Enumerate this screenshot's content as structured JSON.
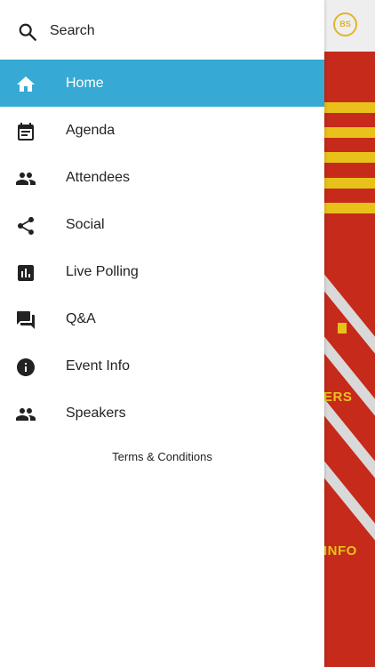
{
  "search": {
    "label": "Search",
    "icon": "search-icon"
  },
  "nav": {
    "active_color": "#36aad4",
    "items": [
      {
        "label": "Home",
        "icon": "home-icon",
        "active": true
      },
      {
        "label": "Agenda",
        "icon": "calendar-icon",
        "active": false
      },
      {
        "label": "Attendees",
        "icon": "people-icon",
        "active": false
      },
      {
        "label": "Social",
        "icon": "share-icon",
        "active": false
      },
      {
        "label": "Live Polling",
        "icon": "poll-icon",
        "active": false
      },
      {
        "label": "Q&A",
        "icon": "forum-icon",
        "active": false
      },
      {
        "label": "Event Info",
        "icon": "info-icon",
        "active": false
      },
      {
        "label": "Speakers",
        "icon": "people-icon",
        "active": false
      }
    ]
  },
  "footer": {
    "terms_label": "Terms & Conditions"
  },
  "background": {
    "badge_text": "BS",
    "brand_red": "#c62a1a",
    "brand_yellow": "#e8c21b",
    "labels": {
      "speakers_fragment": "ERS",
      "info_fragment": "INFO"
    }
  }
}
